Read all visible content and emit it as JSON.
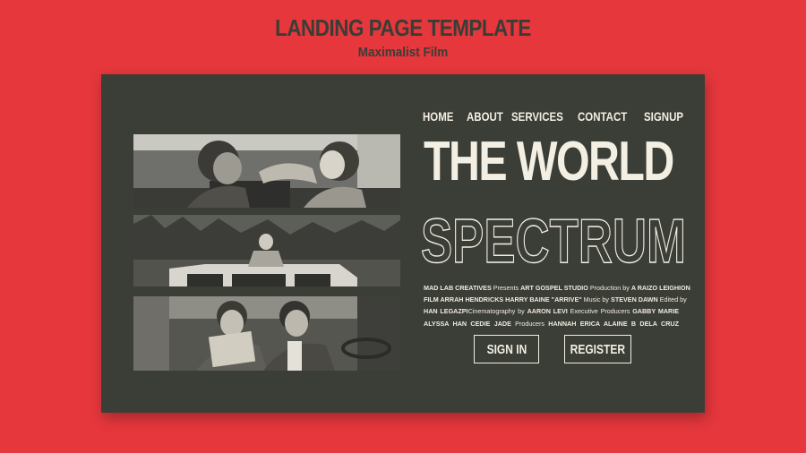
{
  "header": {
    "title": "LANDING PAGE TEMPLATE",
    "subtitle": "Maximalist Film"
  },
  "nav": {
    "items": [
      {
        "label": "HOME"
      },
      {
        "label": "ABOUT"
      },
      {
        "label": "SERVICES"
      },
      {
        "label": "CONTACT"
      },
      {
        "label": "SIGNUP"
      }
    ]
  },
  "hero": {
    "title_line1": "THE WORLD",
    "title_line2": "SPECTRUM"
  },
  "credits": {
    "line1": [
      "MAD LAB CREATIVES",
      " Presents ",
      "ART GOSPEL STUDIO",
      " Production by ",
      "A RAIZO LEIGHION"
    ],
    "line2": [
      "FILM ARRAH HENDRICKS HARRY BAINE \"ARRIVE\"",
      " Music by ",
      "STEVEN DAWN",
      " Edited by"
    ],
    "line3": [
      "HAN LEGAZPI",
      "Cinematography by ",
      "AARON LEVI",
      " Executive Producers ",
      "GABBY MARIE"
    ],
    "line4": [
      "ALYSSA HAN CEDIE JADE",
      " Producers ",
      "HANNAH ERICA ALAINE B DELA CRUZ"
    ]
  },
  "buttons": {
    "signin": "SIGN IN",
    "register": "REGISTER"
  },
  "colors": {
    "background": "#e5373c",
    "card": "#3b3d37",
    "text_light": "#f3efe2",
    "heading_dark": "#3a3d37"
  }
}
